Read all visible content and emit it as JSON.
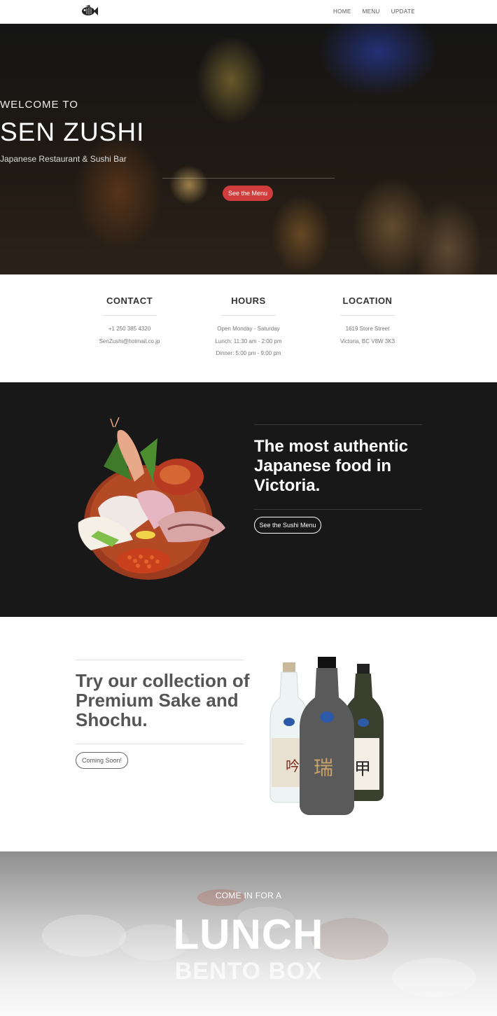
{
  "nav": {
    "logo_icon": "fish-logo-icon",
    "links": [
      "HOME",
      "MENU",
      "UPDATE"
    ]
  },
  "hero": {
    "welcome": "WELCOME TO",
    "title": "SEN ZUSHI",
    "subtitle": "Japanese Restaurant & Sushi Bar",
    "button": "See the Menu"
  },
  "info": {
    "contact": {
      "heading": "CONTACT",
      "lines": [
        "+1 250 385 4320",
        "SenZushi@hotmail.co.jp"
      ]
    },
    "hours": {
      "heading": "HOURS",
      "lines": [
        "Open Monday - Saturday",
        "Lunch: 11:30 am - 2:00 pm",
        "Dinner: 5:00 pm - 9:00 pm"
      ]
    },
    "location": {
      "heading": "LOCATION",
      "lines": [
        "1619 Store Street",
        "Victoria, BC V8W 3K3"
      ]
    }
  },
  "sushi_section": {
    "heading": "The most authentic Japanese food in Victoria.",
    "button": "See the Sushi Menu"
  },
  "sake_section": {
    "heading": "Try our collection of Premium Sake and Shochu.",
    "button": "Coming Soon!"
  },
  "lunch_section": {
    "pre": "COME IN FOR A",
    "title": "LUNCH",
    "subtitle": "BENTO BOX"
  },
  "colors": {
    "accent_red": "#d13d3d",
    "dark_bg": "#181818"
  }
}
